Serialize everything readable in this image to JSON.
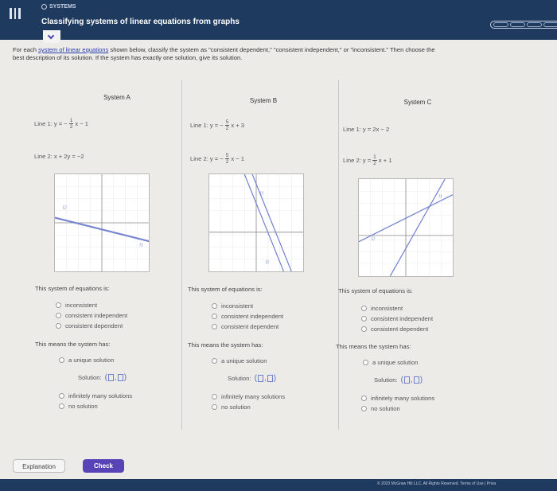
{
  "header": {
    "topic": "SYSTEMS",
    "title": "Classifying systems of linear equations from graphs"
  },
  "instructions": {
    "line1_pre": "For each ",
    "line1_link": "system of linear equations",
    "line1_post": " shown below, classify the system as \"consistent dependent,\" \"consistent independent,\" or \"inconsistent.\" Then choose the",
    "line2": "best description of its solution. If the system has exactly one solution, give its solution."
  },
  "systems": [
    {
      "title": "System A",
      "line1": {
        "label": "Line 1:",
        "lhs": "y = −",
        "num": "1",
        "den": "2",
        "rhs": "x − 1"
      },
      "line2": {
        "label": "Line 2:",
        "expr": "x + 2y = −2"
      },
      "graph_labels": {
        "l1": "l1",
        "l2": "l2"
      }
    },
    {
      "title": "System B",
      "line1": {
        "label": "Line 1:",
        "lhs": "y = −",
        "num": "5",
        "den": "2",
        "rhs": "x + 3"
      },
      "line2": {
        "label": "Line 2:",
        "lhs": "y = −",
        "num": "5",
        "den": "2",
        "rhs": "x − 1"
      },
      "graph_labels": {
        "l1": "l1",
        "l2": "l2"
      }
    },
    {
      "title": "System C",
      "line1": {
        "label": "Line 1:",
        "expr": "y = 2x − 2"
      },
      "line2": {
        "label": "Line 2:",
        "lhs": "y = ",
        "num": "1",
        "den": "2",
        "rhs": "x + 1"
      },
      "graph_labels": {
        "l1": "l1",
        "l2": "l2"
      }
    }
  ],
  "question": {
    "prompt": "This system of equations is:",
    "options": [
      "inconsistent",
      "consistent independent",
      "consistent dependent"
    ],
    "means": "This means the system has:",
    "unique": "a unique solution",
    "solution_label": "Solution:",
    "infinite": "infinitely many solutions",
    "none": "no solution"
  },
  "buttons": {
    "explanation": "Explanation",
    "check": "Check"
  },
  "footer": {
    "text": "© 2023 McGraw Hill LLC. All Rights Reserved.   Terms of Use  |  Priva"
  },
  "colors": {
    "header_bg": "#1f3a5f",
    "accent": "#5944b7",
    "line_color": "#6f7fcf"
  }
}
